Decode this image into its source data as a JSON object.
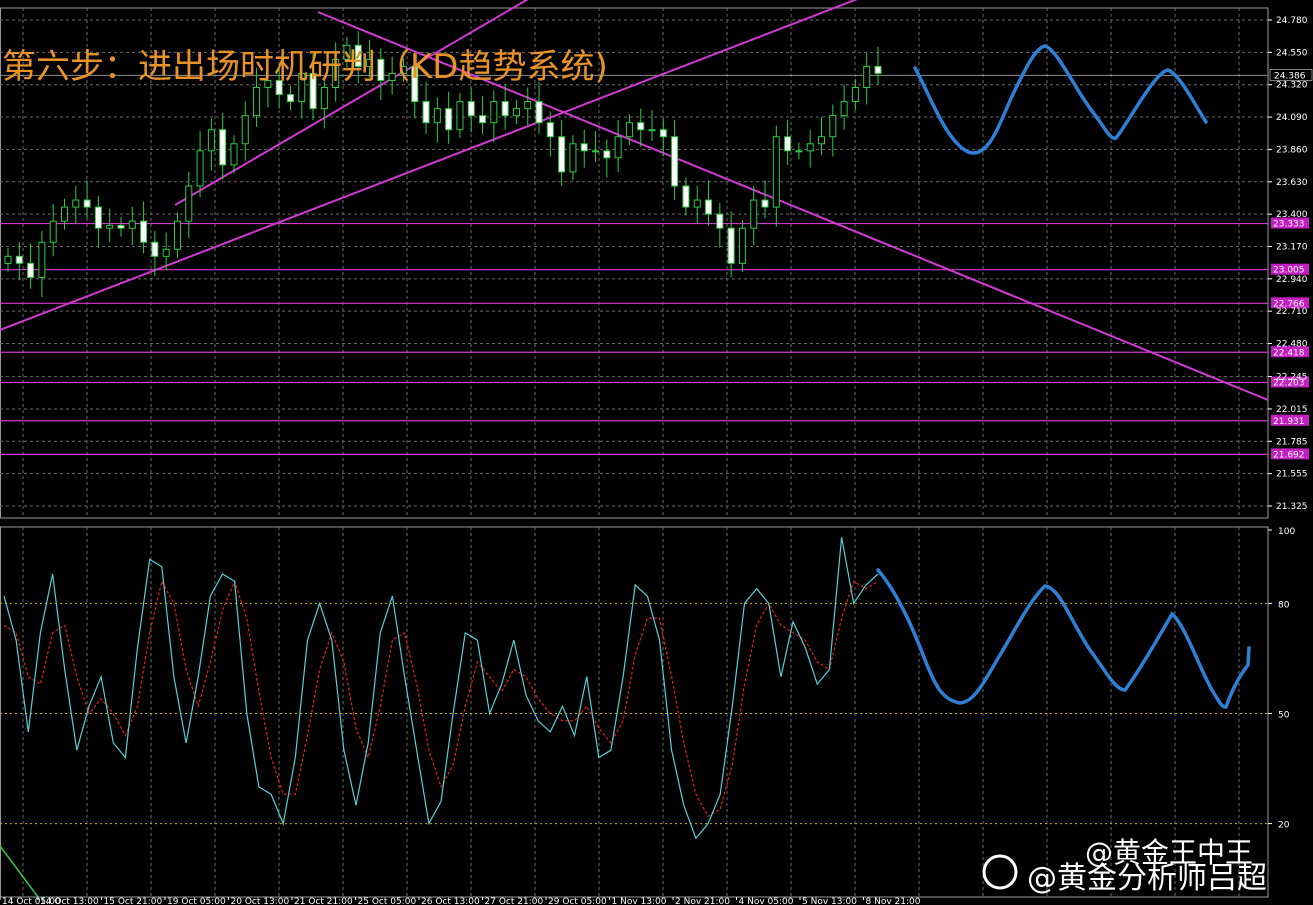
{
  "chart_data": [
    {
      "type": "candlestick",
      "title": "第六步：进出场时机研判（KD趋势系统)",
      "ylim": [
        21.325,
        24.78
      ],
      "y_ticks": [
        "24.780",
        "24.550",
        "24.320",
        "24.090",
        "23.860",
        "23.630",
        "23.400",
        "23.170",
        "22.940",
        "22.710",
        "22.480",
        "22.245",
        "22.015",
        "21.785",
        "21.555",
        "21.325"
      ],
      "current_price": "24.386",
      "horizontal_levels": [
        "23.333",
        "23.005",
        "22.766",
        "22.418",
        "22.203",
        "21.931",
        "21.692"
      ],
      "x_ticks": [
        "14 Oct 05:00",
        "14 Oct 13:00",
        "15 Oct 21:00",
        "19 Oct 05:00",
        "20 Oct 13:00",
        "21 Oct 21:00",
        "25 Oct 05:00",
        "26 Oct 13:00",
        "27 Oct 21:00",
        "29 Oct 05:00",
        "1 Nov 13:00",
        "2 Nov 21:00",
        "4 Nov 05:00",
        "5 Nov 13:00",
        "8 Nov 21:00"
      ],
      "closes": [
        23.1,
        23.05,
        22.95,
        23.2,
        23.35,
        23.45,
        23.5,
        23.45,
        23.3,
        23.32,
        23.3,
        23.35,
        23.2,
        23.1,
        23.15,
        23.35,
        23.6,
        23.85,
        24.0,
        23.75,
        23.9,
        24.1,
        24.3,
        24.35,
        24.25,
        24.2,
        24.4,
        24.15,
        24.3,
        24.5,
        24.6,
        24.45,
        24.5,
        24.35,
        24.4,
        24.45,
        24.2,
        24.05,
        24.15,
        24.0,
        24.2,
        24.1,
        24.05,
        24.2,
        24.1,
        24.15,
        24.2,
        24.05,
        23.95,
        23.7,
        23.9,
        23.85,
        23.85,
        23.8,
        23.95,
        24.05,
        24.0,
        24.0,
        23.95,
        23.6,
        23.45,
        23.5,
        23.4,
        23.3,
        23.05,
        23.3,
        23.5,
        23.45,
        23.95,
        23.85,
        23.85,
        23.9,
        23.95,
        24.1,
        24.2,
        24.3,
        24.45,
        24.4
      ]
    },
    {
      "type": "line",
      "y_ticks": [
        "100",
        "80",
        "50",
        "20"
      ],
      "ylim": [
        0,
        100
      ],
      "k_values": [
        82,
        70,
        45,
        72,
        88,
        62,
        40,
        52,
        60,
        42,
        38,
        68,
        92,
        90,
        60,
        42,
        60,
        82,
        88,
        86,
        50,
        30,
        28,
        20,
        38,
        70,
        80,
        70,
        40,
        25,
        42,
        72,
        82,
        60,
        40,
        20,
        26,
        50,
        72,
        70,
        50,
        58,
        70,
        55,
        48,
        45,
        52,
        44,
        60,
        38,
        40,
        60,
        85,
        82,
        70,
        40,
        25,
        16,
        20,
        28,
        52,
        80,
        84,
        80,
        60,
        75,
        68,
        58,
        62,
        98,
        80,
        85,
        88
      ],
      "d_values": [
        74,
        72,
        60,
        58,
        72,
        74,
        60,
        50,
        54,
        50,
        44,
        52,
        72,
        86,
        80,
        62,
        52,
        64,
        78,
        86,
        76,
        56,
        38,
        28,
        28,
        44,
        62,
        72,
        64,
        46,
        38,
        52,
        70,
        72,
        58,
        40,
        30,
        36,
        52,
        64,
        60,
        56,
        62,
        60,
        54,
        50,
        48,
        48,
        52,
        46,
        42,
        48,
        66,
        76,
        76,
        60,
        42,
        28,
        22,
        24,
        36,
        58,
        74,
        80,
        74,
        72,
        70,
        64,
        62,
        76,
        86,
        84,
        86
      ]
    }
  ],
  "watermark": {
    "line1": "@黄金王中王",
    "line2": "@黄金分析师吕超"
  }
}
